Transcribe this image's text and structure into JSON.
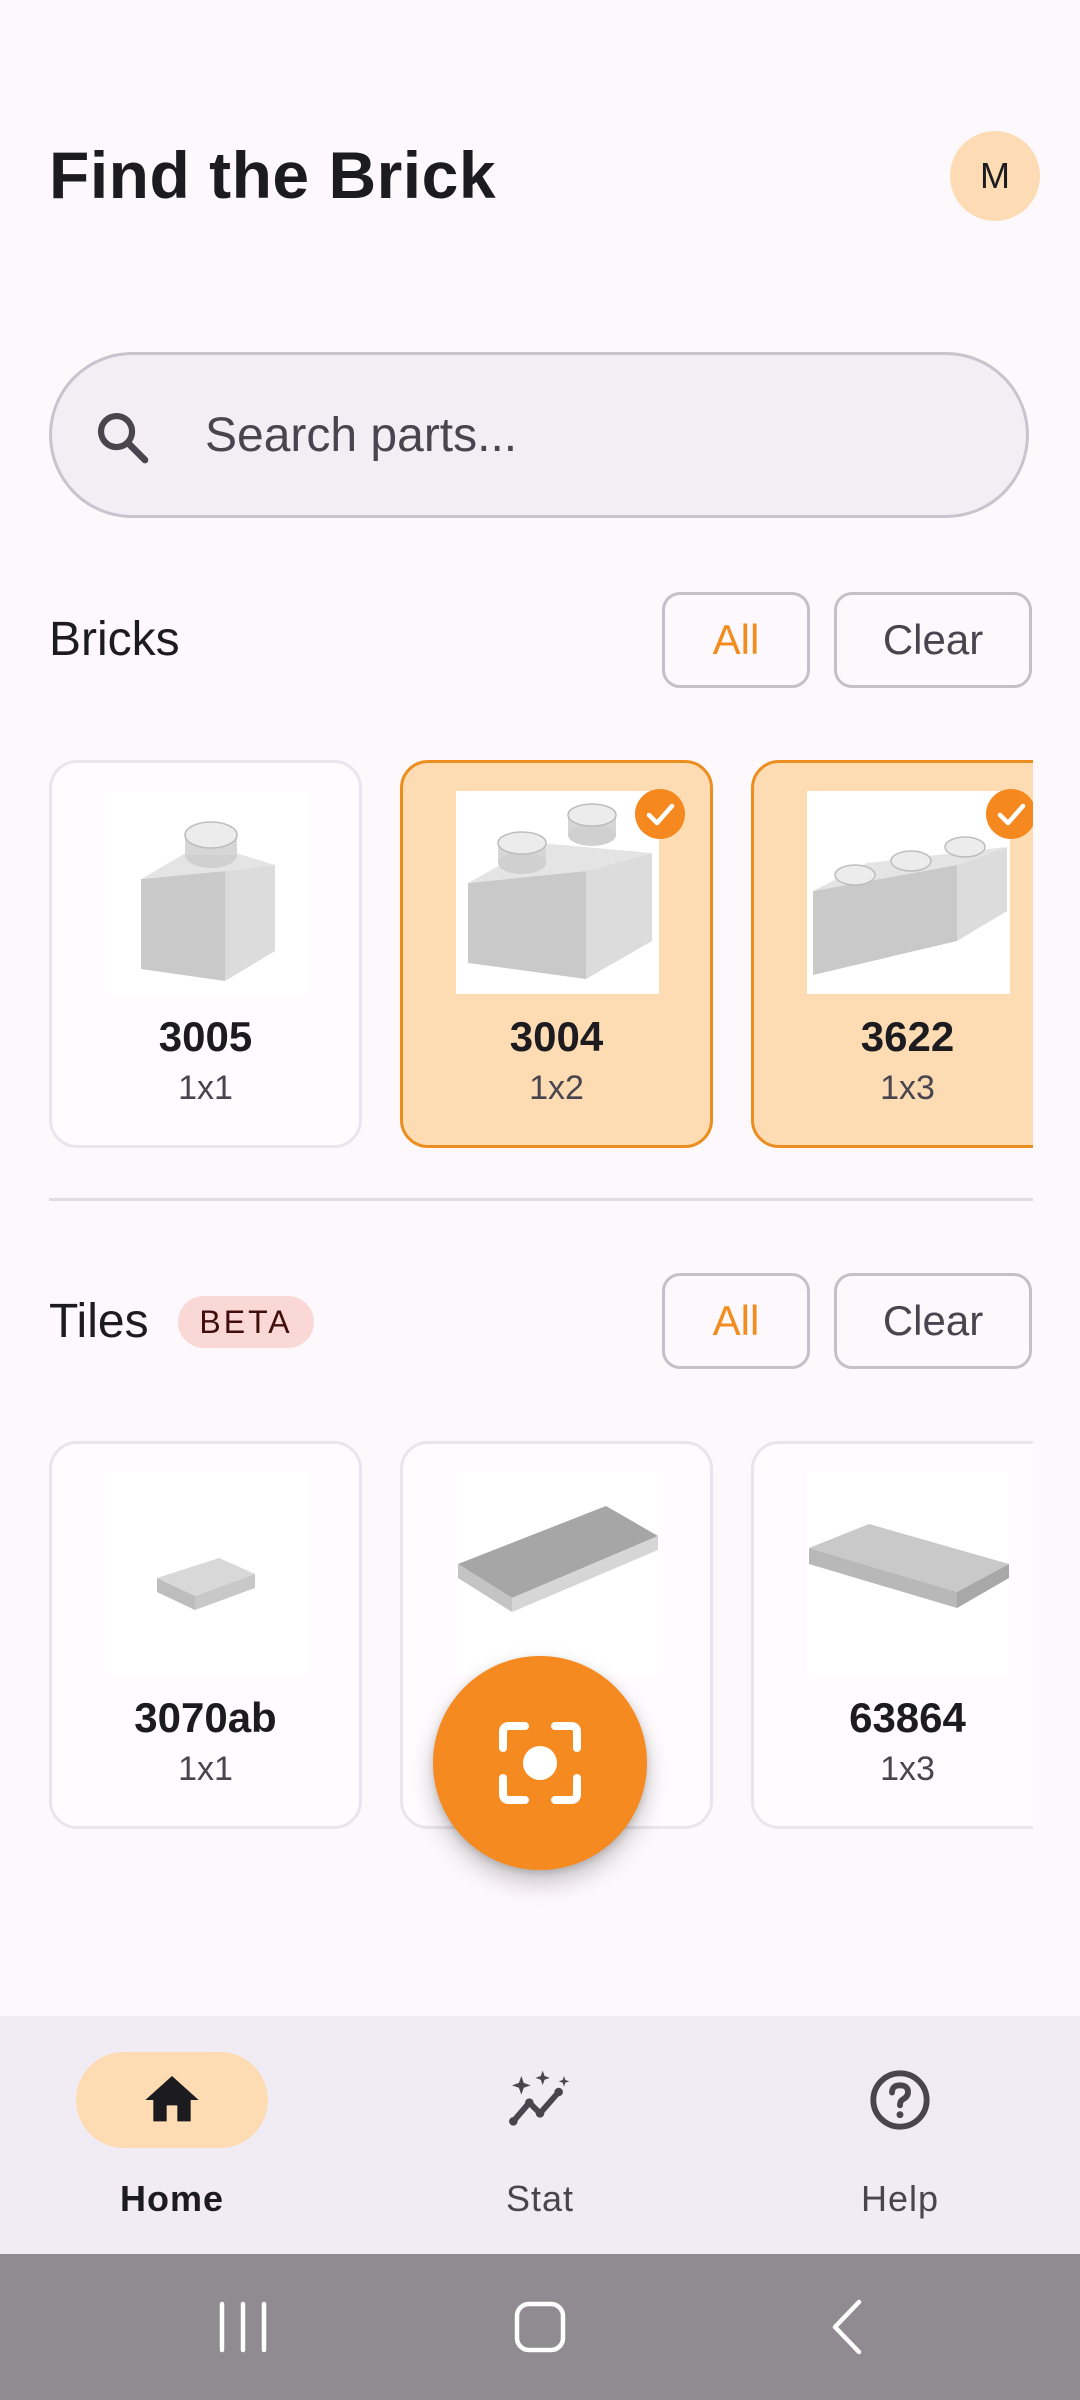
{
  "header": {
    "title": "Find the Brick",
    "avatar_initial": "M"
  },
  "search": {
    "placeholder": "Search parts..."
  },
  "bricks": {
    "title": "Bricks",
    "all_label": "All",
    "clear_label": "Clear",
    "items": [
      {
        "code": "3005",
        "size": "1x1",
        "selected": false
      },
      {
        "code": "3004",
        "size": "1x2",
        "selected": true
      },
      {
        "code": "3622",
        "size": "1x3",
        "selected": true
      }
    ]
  },
  "tiles": {
    "title": "Tiles",
    "badge": "BETA",
    "all_label": "All",
    "clear_label": "Clear",
    "items": [
      {
        "code": "3070ab",
        "size": "1x1",
        "selected": false
      },
      {
        "code": "",
        "size": "",
        "selected": false
      },
      {
        "code": "63864",
        "size": "1x3",
        "selected": false
      }
    ]
  },
  "fab": {
    "icon": "scan-icon"
  },
  "bottom_nav": {
    "items": [
      {
        "label": "Home",
        "icon": "home-icon",
        "active": true
      },
      {
        "label": "Stat",
        "icon": "sparkle-chart-icon",
        "active": false
      },
      {
        "label": "Help",
        "icon": "help-circle-icon",
        "active": false
      }
    ]
  },
  "colors": {
    "accent": "#f48a20",
    "accent_container": "#fddcb3",
    "background": "#fdf8fb",
    "badge_background": "#fad8d6"
  }
}
